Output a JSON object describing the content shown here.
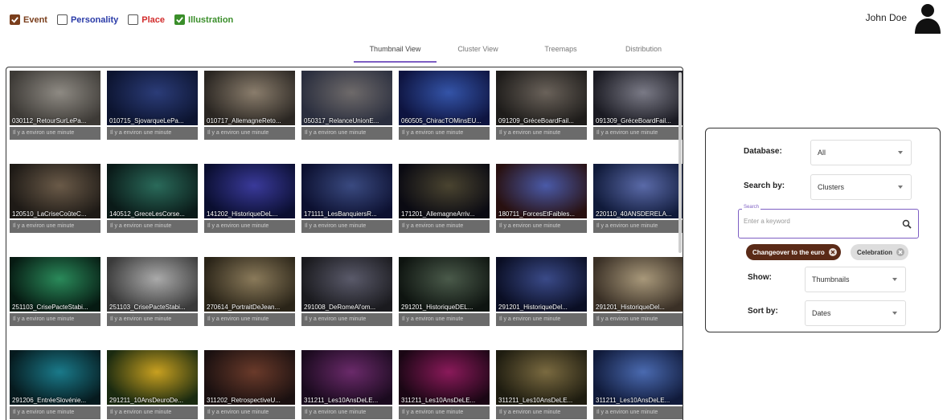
{
  "filters": [
    {
      "label": "Event",
      "checked": true,
      "color": "#7a3e1c"
    },
    {
      "label": "Personality",
      "checked": false,
      "color": "#2a3ba8"
    },
    {
      "label": "Place",
      "checked": false,
      "color": "#d22c2c"
    },
    {
      "label": "Illustration",
      "checked": true,
      "color": "#3a8e2a"
    }
  ],
  "user": {
    "name": "John Doe",
    "avatar_icon": "user-silhouette-icon"
  },
  "tabs": [
    "Thumbnail View",
    "Cluster View",
    "Treemaps",
    "Distribution"
  ],
  "active_tab": "Thumbnail View",
  "accent_color": "#7d5ec3",
  "thumbnails": [
    {
      "title": "030112_RetourSurLePa...",
      "meta": "Il y a environ une minute"
    },
    {
      "title": "010715_SjovarqueLePa...",
      "meta": "Il y a environ une minute"
    },
    {
      "title": "010717_AllemagneReto...",
      "meta": "Il y a environ une minute"
    },
    {
      "title": "050317_RelanceUnionE...",
      "meta": "Il y a environ une minute"
    },
    {
      "title": "060505_ChiracTOMinsEU...",
      "meta": "Il y a environ une minute"
    },
    {
      "title": "091209_GréceBoardFail...",
      "meta": "Il y a environ une minute"
    },
    {
      "title": "091309_GréceBoardFail...",
      "meta": "Il y a environ une minute"
    },
    {
      "title": "120510_LaCriseCoûteC...",
      "meta": "Il y a environ une minute"
    },
    {
      "title": "140512_GreceLesCorse...",
      "meta": "Il y a environ une minute"
    },
    {
      "title": "141202_HistoriqueDeL...",
      "meta": "Il y a environ une minute"
    },
    {
      "title": "171111_LesBanquiersR...",
      "meta": "Il y a environ une minute"
    },
    {
      "title": "171201_AllemagneArriv...",
      "meta": "Il y a environ une minute"
    },
    {
      "title": "180711_ForcesEtFaibles...",
      "meta": "Il y a environ une minute"
    },
    {
      "title": "220110_40ANSDERELA...",
      "meta": "Il y a environ une minute"
    },
    {
      "title": "251103_CrisePacteStabi...",
      "meta": "Il y a environ une minute"
    },
    {
      "title": "251103_CrisePacteStabi...",
      "meta": "Il y a environ une minute"
    },
    {
      "title": "270614_PortraitDeJean...",
      "meta": "Il y a environ une minute"
    },
    {
      "title": "291008_DeRomeAl'om...",
      "meta": "Il y a environ une minute"
    },
    {
      "title": "291201_HistoriqueDEL...",
      "meta": "Il y a environ une minute"
    },
    {
      "title": "291201_HistoriqueDel...",
      "meta": "Il y a environ une minute"
    },
    {
      "title": "291201_HistoriqueDel...",
      "meta": "Il y a environ une minute"
    },
    {
      "title": "291206_EntréeSlovénie...",
      "meta": "Il y a environ une minute"
    },
    {
      "title": "291211_10AnsDeuroDe...",
      "meta": "Il y a environ une minute"
    },
    {
      "title": "311202_RetrospectiveU...",
      "meta": "Il y a environ une minute"
    },
    {
      "title": "311211_Les10AnsDeLE...",
      "meta": "Il y a environ une minute"
    },
    {
      "title": "311211_Les10AnsDeLE...",
      "meta": "Il y a environ une minute"
    },
    {
      "title": "311211_Les10AnsDeLE...",
      "meta": "Il y a environ une minute"
    },
    {
      "title": "311211_Les10AnsDeLE...",
      "meta": "Il y a environ une minute"
    }
  ],
  "search_panel": {
    "database": {
      "label": "Database:",
      "value": "All"
    },
    "search_by": {
      "label": "Search by:",
      "value": "Clusters"
    },
    "search": {
      "legend": "Search",
      "placeholder": "Enter a keyword",
      "value": ""
    },
    "chips": [
      {
        "label": "Changeover to the euro",
        "style": "dark"
      },
      {
        "label": "Celebration",
        "style": "light"
      }
    ],
    "show": {
      "label": "Show:",
      "value": "Thumbnails"
    },
    "sort_by": {
      "label": "Sort by:",
      "value": "Dates"
    }
  }
}
